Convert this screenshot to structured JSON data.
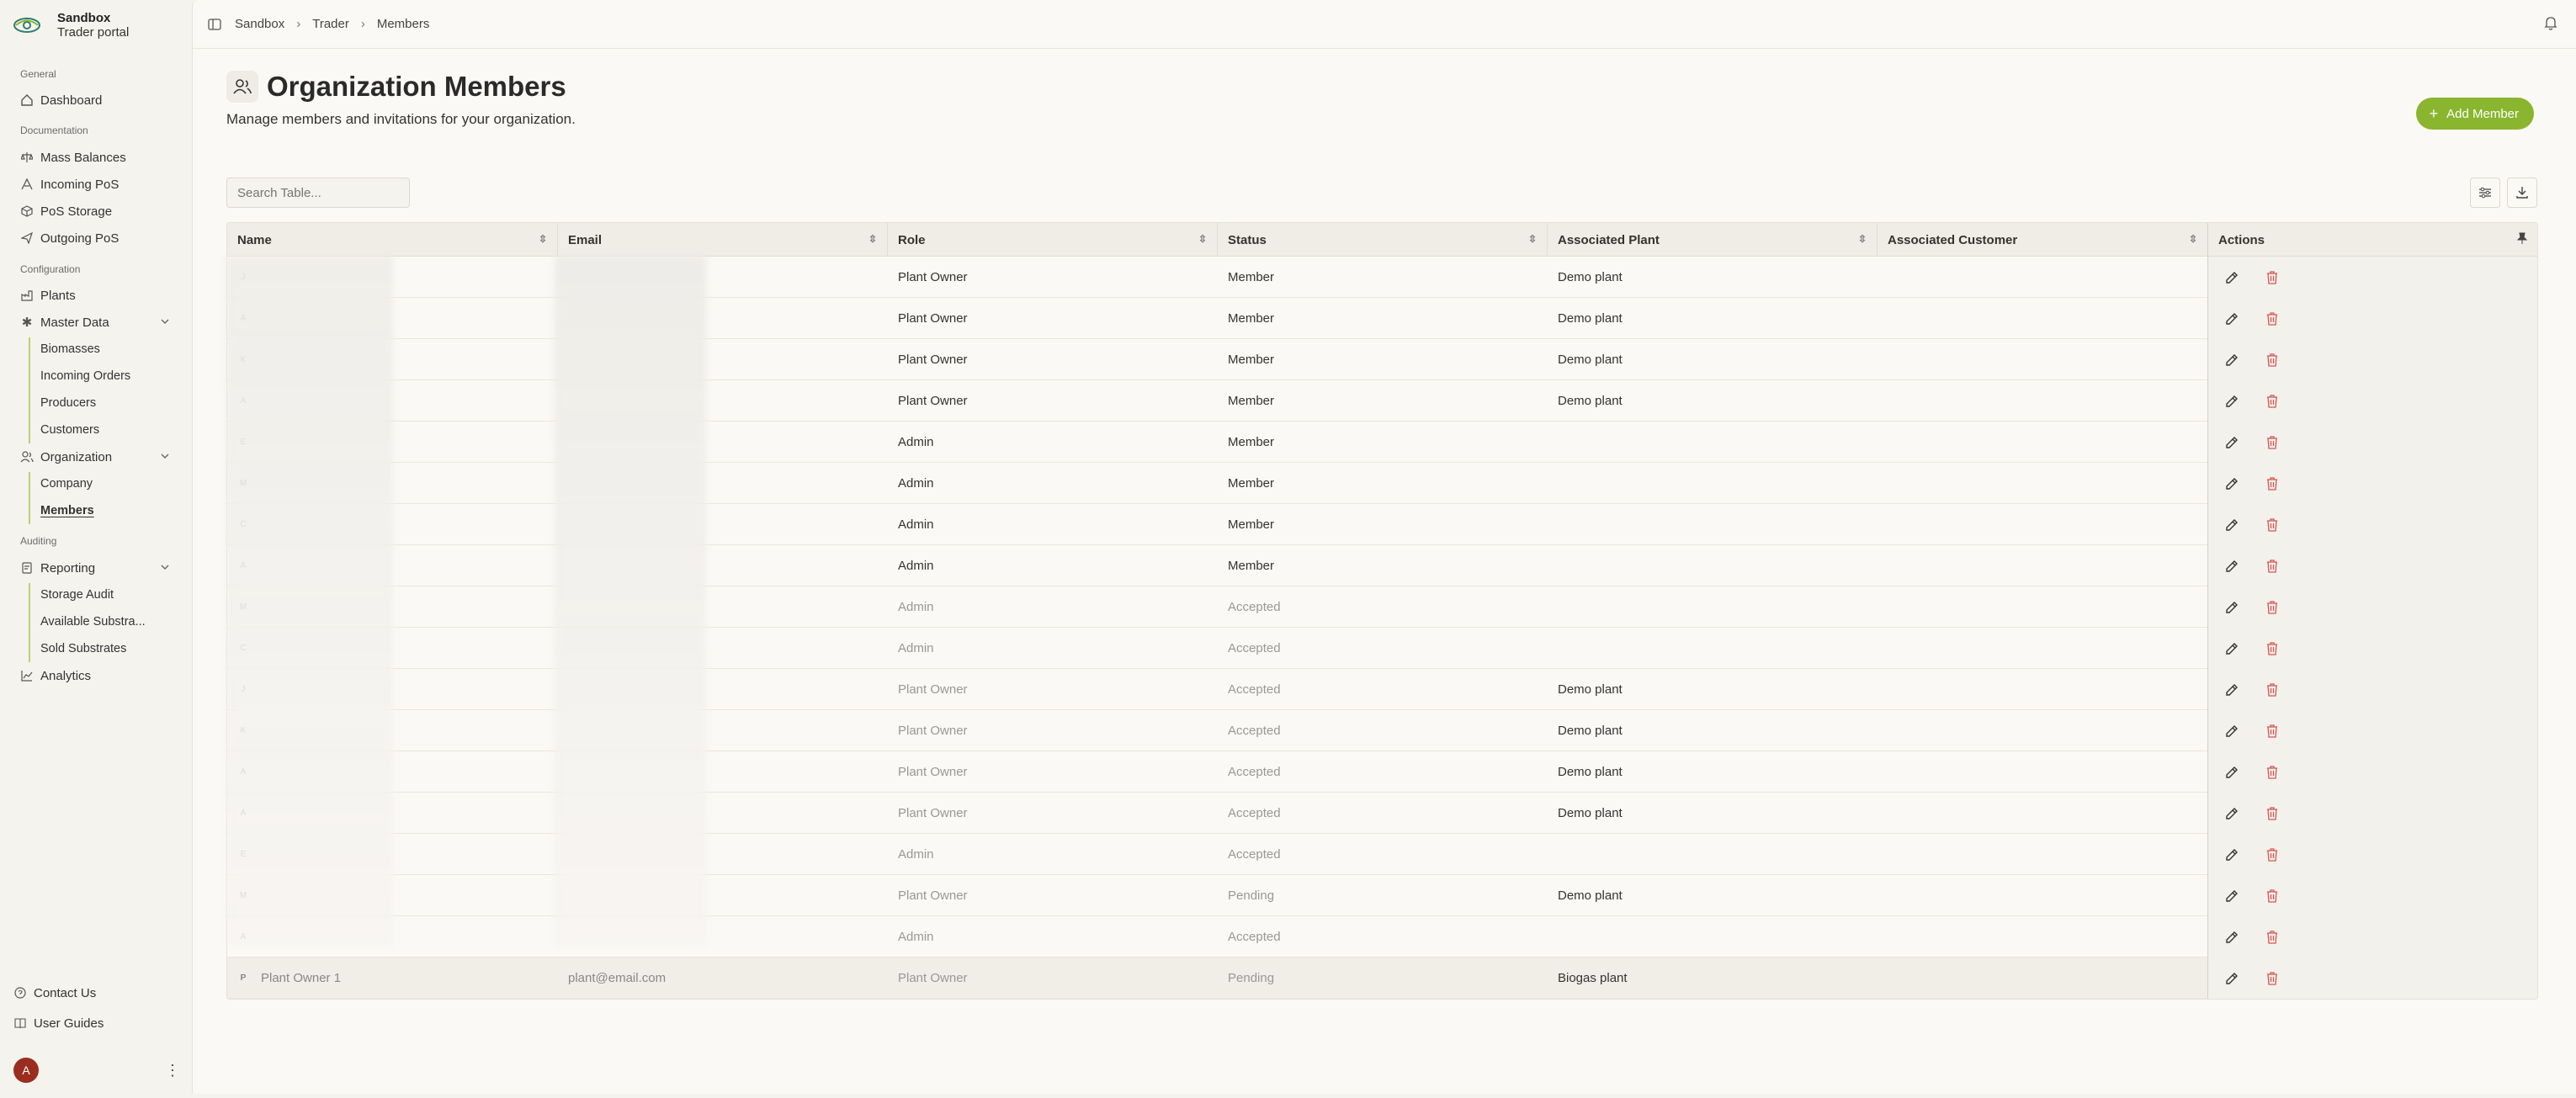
{
  "brand": {
    "name": "Sandbox",
    "subtitle": "Trader portal"
  },
  "sidebar": {
    "sections": {
      "general": "General",
      "documentation": "Documentation",
      "configuration": "Configuration",
      "auditing": "Auditing"
    },
    "items": {
      "dashboard": "Dashboard",
      "mass_balances": "Mass Balances",
      "incoming_pos": "Incoming PoS",
      "pos_storage": "PoS Storage",
      "outgoing_pos": "Outgoing PoS",
      "plants": "Plants",
      "master_data": "Master Data",
      "biomasses": "Biomasses",
      "incoming_orders": "Incoming Orders",
      "producers": "Producers",
      "customers": "Customers",
      "organization": "Organization",
      "company": "Company",
      "members": "Members",
      "reporting": "Reporting",
      "storage_audit": "Storage Audit",
      "available_substrates": "Available Substra...",
      "sold_substrates": "Sold Substrates",
      "analytics": "Analytics"
    },
    "footer": {
      "contact": "Contact Us",
      "guides": "User Guides",
      "avatar_initial": "A"
    }
  },
  "breadcrumb": [
    "Sandbox",
    "Trader",
    "Members"
  ],
  "page": {
    "title": "Organization Members",
    "subtitle": "Manage members and invitations for your organization.",
    "add_button": "Add Member",
    "search_placeholder": "Search Table..."
  },
  "table": {
    "columns": [
      "Name",
      "Email",
      "Role",
      "Status",
      "Associated Plant",
      "Associated Customer",
      "Actions"
    ],
    "rows": [
      {
        "initial": "J",
        "name": "",
        "email": "",
        "role": "Plant Owner",
        "status": "Member",
        "plant": "Demo plant",
        "customer": "",
        "dim": false
      },
      {
        "initial": "A",
        "name": "",
        "email": "",
        "role": "Plant Owner",
        "status": "Member",
        "plant": "Demo plant",
        "customer": "",
        "dim": false
      },
      {
        "initial": "K",
        "name": "",
        "email": "",
        "role": "Plant Owner",
        "status": "Member",
        "plant": "Demo plant",
        "customer": "",
        "dim": false
      },
      {
        "initial": "A",
        "name": "",
        "email": "",
        "role": "Plant Owner",
        "status": "Member",
        "plant": "Demo plant",
        "customer": "",
        "dim": false
      },
      {
        "initial": "E",
        "name": "",
        "email": "",
        "role": "Admin",
        "status": "Member",
        "plant": "",
        "customer": "",
        "dim": false
      },
      {
        "initial": "M",
        "name": "",
        "email": "",
        "role": "Admin",
        "status": "Member",
        "plant": "",
        "customer": "",
        "dim": false
      },
      {
        "initial": "C",
        "name": "",
        "email": "",
        "role": "Admin",
        "status": "Member",
        "plant": "",
        "customer": "",
        "dim": false
      },
      {
        "initial": "A",
        "name": "",
        "email": "",
        "role": "Admin",
        "status": "Member",
        "plant": "",
        "customer": "",
        "dim": false
      },
      {
        "initial": "M",
        "name": "",
        "email": "",
        "role": "Admin",
        "status": "Accepted",
        "plant": "",
        "customer": "",
        "dim": true
      },
      {
        "initial": "C",
        "name": "",
        "email": "",
        "role": "Admin",
        "status": "Accepted",
        "plant": "",
        "customer": "",
        "dim": true
      },
      {
        "initial": "J",
        "name": "",
        "email": "",
        "role": "Plant Owner",
        "status": "Accepted",
        "plant": "Demo plant",
        "customer": "",
        "dim": true
      },
      {
        "initial": "K",
        "name": "",
        "email": "",
        "role": "Plant Owner",
        "status": "Accepted",
        "plant": "Demo plant",
        "customer": "",
        "dim": true
      },
      {
        "initial": "A",
        "name": "",
        "email": "",
        "role": "Plant Owner",
        "status": "Accepted",
        "plant": "Demo plant",
        "customer": "",
        "dim": true
      },
      {
        "initial": "A",
        "name": "",
        "email": "",
        "role": "Plant Owner",
        "status": "Accepted",
        "plant": "Demo plant",
        "customer": "",
        "dim": true
      },
      {
        "initial": "E",
        "name": "",
        "email": "",
        "role": "Admin",
        "status": "Accepted",
        "plant": "",
        "customer": "",
        "dim": true
      },
      {
        "initial": "M",
        "name": "",
        "email": "",
        "role": "Plant Owner",
        "status": "Pending",
        "plant": "Demo plant",
        "customer": "",
        "dim": true
      },
      {
        "initial": "A",
        "name": "",
        "email": "",
        "role": "Admin",
        "status": "Accepted",
        "plant": "",
        "customer": "",
        "dim": true
      },
      {
        "initial": "P",
        "name": "Plant Owner 1",
        "email": "plant@email.com",
        "role": "Plant Owner",
        "status": "Pending",
        "plant": "Biogas plant",
        "customer": "",
        "dim": true
      }
    ]
  },
  "colors": {
    "accent": "#8ab52f",
    "danger": "#d9534f",
    "avatar": "#9b2d1f"
  }
}
